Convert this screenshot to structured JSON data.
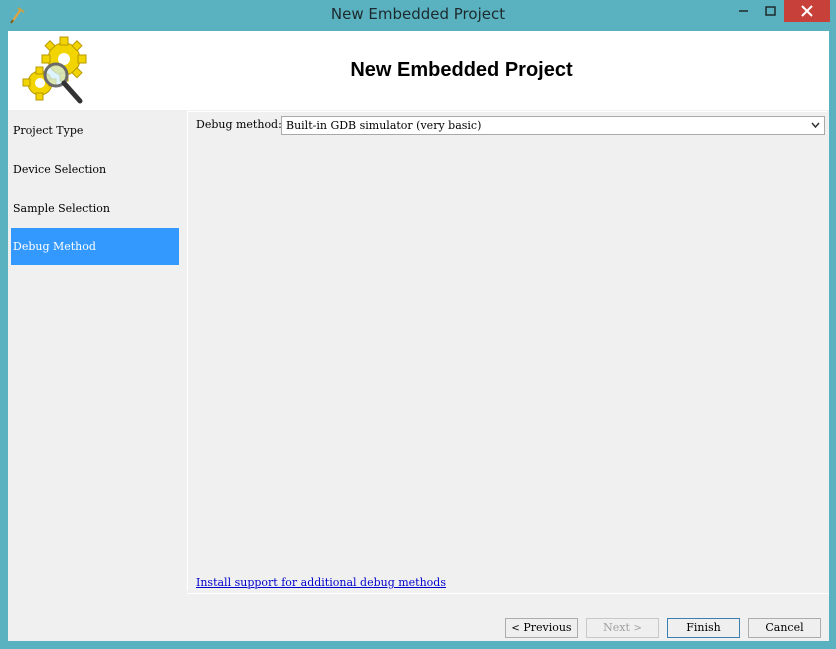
{
  "window": {
    "title": "New Embedded Project",
    "close_glyph": "✕",
    "minimize_glyph": "—",
    "maximize_glyph": "□"
  },
  "header": {
    "title": "New Embedded Project",
    "logo_icon": "gears-magnifier-icon"
  },
  "sidebar": {
    "items": [
      {
        "label": "Project Type",
        "active": false
      },
      {
        "label": "Device Selection",
        "active": false
      },
      {
        "label": "Sample Selection",
        "active": false
      },
      {
        "label": "Debug Method",
        "active": true
      }
    ]
  },
  "panel": {
    "debug_label": "Debug method:",
    "debug_value": "Built-in GDB simulator (very basic)",
    "install_link": "Install support for additional debug methods"
  },
  "buttons": {
    "previous": {
      "arrow": "<",
      "label": "Previous"
    },
    "next": {
      "label": "Next",
      "arrow": ">"
    },
    "finish": "Finish",
    "cancel": "Cancel"
  },
  "colors": {
    "frame": "#5ab2c0",
    "close": "#c7403a",
    "selection": "#3399ff",
    "link": "#0000cc"
  }
}
